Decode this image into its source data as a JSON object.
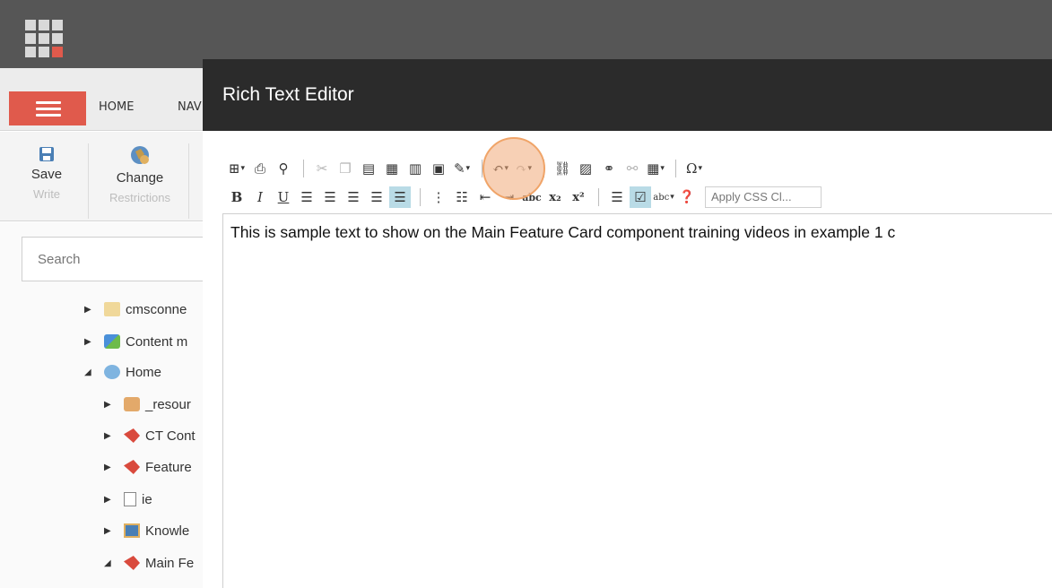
{
  "app": {
    "tabs": [
      "HOME",
      "NAV"
    ]
  },
  "ribbon": {
    "save": {
      "label": "Save",
      "sub": "Write"
    },
    "change": {
      "label": "Change",
      "sub": "Restrictions"
    }
  },
  "search": {
    "placeholder": "Search"
  },
  "tree": [
    {
      "label": "cmsconne",
      "arrow": "right",
      "icon": "folder-icon"
    },
    {
      "label": "Content m",
      "arrow": "right",
      "icon": "content-icon"
    },
    {
      "label": "Home",
      "arrow": "down",
      "icon": "home-icon"
    },
    {
      "label": "_resour",
      "arrow": "right",
      "icon": "resource-icon"
    },
    {
      "label": "CT Cont",
      "arrow": "right",
      "icon": "component-icon"
    },
    {
      "label": "Feature",
      "arrow": "right",
      "icon": "component-icon"
    },
    {
      "label": "ie",
      "arrow": "right",
      "icon": "page-icon"
    },
    {
      "label": "Knowle",
      "arrow": "right",
      "icon": "knowledge-icon"
    },
    {
      "label": "Main Fe",
      "arrow": "down",
      "icon": "component-icon"
    }
  ],
  "modal": {
    "title": "Rich Text Editor",
    "css_select": "Apply CSS Cl...",
    "content": "This is sample text to show on the Main Feature Card component training videos in example 1 c"
  },
  "toolbar": {
    "row1": [
      "add-icon",
      "print-icon",
      "find-icon",
      "cut-icon",
      "copy-icon",
      "paste-icon",
      "paste-word-icon",
      "paste-plain-icon",
      "paste-html-icon",
      "format-stripper-icon",
      "undo-icon",
      "redo-icon",
      "link-icon",
      "image-icon",
      "link-manager-icon",
      "unlink-icon",
      "table-icon",
      "special-char-icon"
    ],
    "row2": [
      "bold-icon",
      "italic-icon",
      "underline-icon",
      "align-left-icon",
      "align-center-icon",
      "align-right-icon",
      "justify-icon",
      "strike-through-icon",
      "numbered-list-icon",
      "bullet-list-icon",
      "outdent-icon",
      "indent-icon",
      "strikethrough-abc-icon",
      "subscript-icon",
      "superscript-icon",
      "horizontal-rule-icon",
      "design-mode-icon",
      "spellcheck-icon",
      "help-icon"
    ],
    "labels": {
      "bold": "B",
      "italic": "I",
      "underline": "U",
      "omega": "Ω",
      "abc": "abc",
      "sub": "x₂",
      "sup": "x²",
      "spell": "abc"
    }
  },
  "colors": {
    "topbar": "#565656",
    "menu_red": "#e05a4c",
    "modal_header": "#2b2b2b",
    "active_button": "#b9dbe6",
    "highlight": "#f0a468"
  }
}
